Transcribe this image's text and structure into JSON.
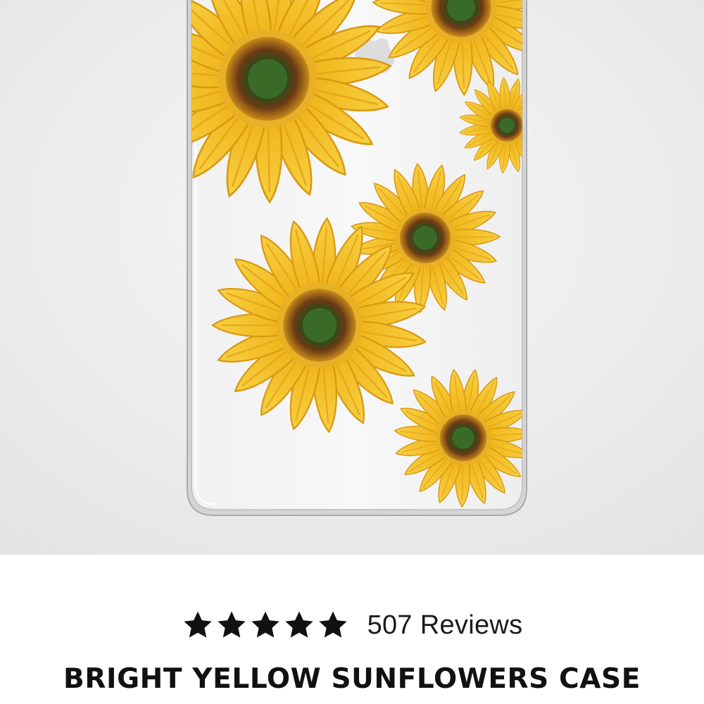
{
  "product": {
    "image_alt": "Bright Yellow Sunflowers clear phone case",
    "rating": {
      "stars": 5,
      "max_stars": 5,
      "reviews_text": "507 Reviews"
    },
    "title": "BRIGHT YELLOW SUNFLOWERS CASE"
  },
  "colors": {
    "background": "#ffffff",
    "photo_background": "#eeeeee",
    "petal": "#f4c22a",
    "petal_dark": "#d99a12",
    "flower_center": "#3f5a22",
    "center_ring": "#6b3a12",
    "text": "#111111"
  }
}
